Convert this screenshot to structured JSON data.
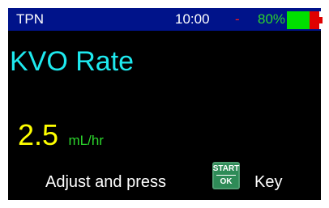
{
  "status_bar": {
    "program": "TPN",
    "time": "10:00",
    "separator": "-",
    "battery_percent": "80%",
    "battery_level": 0.7
  },
  "title": "KVO Rate",
  "rate": {
    "whole": "2",
    "decimal": ".5",
    "units": "mL/hr"
  },
  "prompt": {
    "before": "Adjust and press",
    "after": "Key"
  },
  "key": {
    "top_label": "START",
    "bottom_label": "OK",
    "icon": "start-ok-key-icon"
  },
  "colors": {
    "status_bar_bg": "#00138a",
    "title": "#1ee9ef",
    "rate_value": "#ffff00",
    "units": "#2cd52c",
    "separator": "#ff1a1a",
    "battery_percent": "#2cd52c",
    "battery_green": "#00e000",
    "battery_red": "#e00000",
    "key_bg": "#2e8b57"
  }
}
